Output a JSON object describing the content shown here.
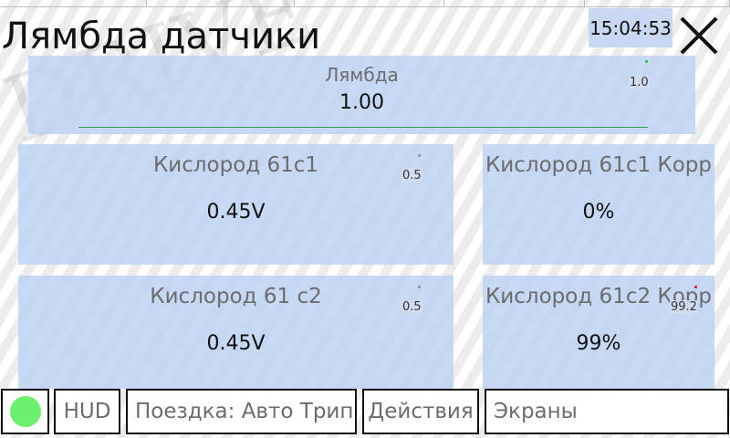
{
  "window": {
    "title": "Лямбда датчики",
    "watermark": "DRIVE",
    "clock": "15:04:53"
  },
  "gauges": [
    {
      "label": "Лямбда",
      "value": "1.00",
      "mini_label": "1.0",
      "dot_color": "#22c55e",
      "line_color": "#2e9e4a"
    },
    {
      "label": "Кислород 61с1",
      "value": "0.45V",
      "mini_label": "0.5",
      "dot_color": "#999999"
    },
    {
      "label": "Кислород 61с1 Корр",
      "value": "0%"
    },
    {
      "label": "Кислород 61 с2",
      "value": "0.45V",
      "mini_label": "0.5",
      "dot_color": "#999999"
    },
    {
      "label": "Кислород 61с2 Корр",
      "value": "99%",
      "mini_label": "99.2",
      "dot_color": "#cc3333"
    }
  ],
  "bottom_bar": {
    "status_color": "#6df06d",
    "hud_label": "HUD",
    "trip_label": "Поездка: Авто Трип",
    "actions_label": "Действия",
    "screens_label": "Экраны"
  },
  "icons": {
    "close": "close-icon",
    "status": "status-indicator-icon"
  }
}
